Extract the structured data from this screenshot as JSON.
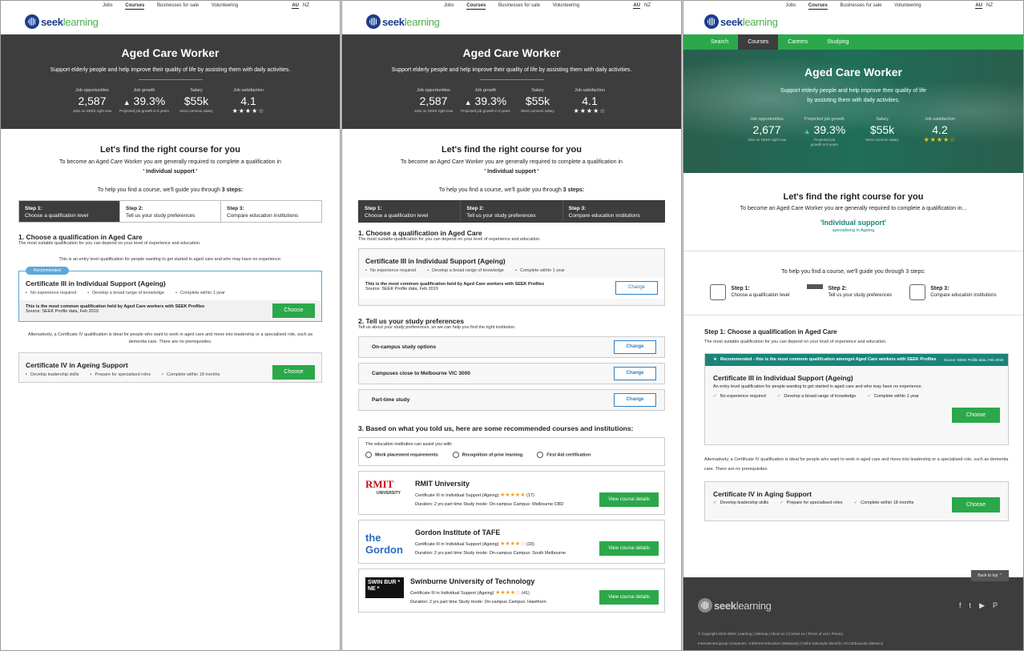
{
  "topnav": {
    "links": [
      "Jobs",
      "Courses",
      "Businesses for sale",
      "Volunteering"
    ],
    "locale": [
      "AU",
      "NZ"
    ]
  },
  "logo": {
    "seek": "seek",
    "learning": "learning"
  },
  "hero": {
    "title": "Aged Care Worker",
    "subtitle": "Support elderly people and help improve their quality of life by assisting them with daily activities.",
    "stats": [
      {
        "label": "Job opportunities",
        "value": "2,587",
        "note": "Jobs on SEEK right now"
      },
      {
        "label": "Job growth",
        "value": "39.3%",
        "note": "Projected job growth in 5 years"
      },
      {
        "label": "Salary",
        "value": "$55k",
        "note": "Most common salary"
      },
      {
        "label": "Job satisfaction",
        "value": "4.1",
        "stars": "★★★★☆"
      }
    ]
  },
  "intro": {
    "title": "Let's find the right course for you",
    "line": "To become an Aged Care Worker you are generally required to complete a qualification in",
    "qualification": "' Individual support '",
    "guide_pre": "To help you find a course, we'll guide you through",
    "guide_bold": "3 steps:"
  },
  "steps": [
    {
      "num": "Step 1:",
      "label": "Choose a qualification level"
    },
    {
      "num": "Step 2:",
      "label": "Tell us your study preferences"
    },
    {
      "num": "Step 3:",
      "label": "Compare education institutions"
    }
  ],
  "p1": {
    "section": "1. Choose a qualification in Aged Care",
    "section_sub": "The most suitable qualification for you can depend on your level of experience and education.",
    "entry_note": "This is an entry level qualification for people wanting to get started in aged care and who may have no experience.",
    "badge": "Recommended",
    "cert3": {
      "title": "Certificate III in Individual Support (Ageing)",
      "features": [
        "No experience required",
        "Develop a broad range of knowledge",
        "Complete within 1 year"
      ],
      "foot_bold": "This is the most common qualification held by Aged Care workers with SEEK Profiles",
      "foot_src": "Source: SEEK Profile data, Feb 2019",
      "button": "Choose"
    },
    "alt_text": "Alternatively, a Certificate IV qualification is ideal for people who want to work in aged care and move into leadership or a specialised role, such as dementia care. There are no prerequisites.",
    "cert4": {
      "title": "Certificate IV in Ageing Support",
      "features": [
        "Develop leadership skills",
        "Prepare for specialised roles",
        "Complete within 18 months"
      ],
      "button": "Choose"
    }
  },
  "p2": {
    "section1": "1. Choose a qualification in Aged Care",
    "section1_sub": "The most suitable qualification for you can depend on your level of experience and education.",
    "cert3": {
      "title": "Certificate III in Individual Support (Ageing)",
      "features": [
        "No experience required",
        "Develop a broad range of knowledge",
        "Complete within 1 year"
      ],
      "foot_bold": "This is the most common qualification held by Aged Care workers with SEEK Profiles",
      "foot_src": "Source: SEEK Profile data, Feb 2019",
      "button": "Change"
    },
    "section2": "2. Tell us your study preferences",
    "section2_sub": "Tell us about your study preferences, so we can help you find the right institution.",
    "prefs": [
      "On-campus study options",
      "Campuses close to Melbourne VIC 3000",
      "Part-time study"
    ],
    "change": "Change",
    "section3": "3. Based on what you told us, here are some recommended courses and institutions:",
    "assist_title": "The education institution can assist you with:",
    "assist": [
      "Work placement requirements",
      "Recognition of prior learning",
      "First Aid certification"
    ],
    "institutions": [
      {
        "logo": "RMIT",
        "logo_sub": "UNIVERSITY",
        "name": "RMIT University",
        "cert": "Certificate III in Individual Support (Ageing)",
        "stars": "★★★★★",
        "count": "(17)",
        "details": "Duration: 2 yrs part time   Study mode: On-campus   Campus: Melbourne CBD",
        "button": "View course details"
      },
      {
        "logo": "the Gordon",
        "logo_sub": "",
        "name": "Gordon Institute of TAFE",
        "cert": "Certificate III in Individual Support (Ageing)",
        "stars": "★★★★☆",
        "count": "(33)",
        "details": "Duration: 2 yrs part time   Study mode: On-campus   Campus: South Melbourne",
        "button": "View course details"
      },
      {
        "logo": "SWIN BUR * NE *",
        "logo_sub": "",
        "name": "Swinburne University of Technology",
        "cert": "Certificate III in Individual Support (Ageing)",
        "stars": "★★★★☆",
        "count": "(41)",
        "details": "Duration: 2 yrs part time   Study mode: On-campus   Campus: Hawthorn",
        "button": "View course details"
      }
    ]
  },
  "p3": {
    "nav": [
      "Search",
      "Courses",
      "Careers",
      "Studying"
    ],
    "hero": {
      "title": "Aged Care Worker",
      "subtitle": "Support elderly people and help improve their quality of life by assisting them with daily activities.",
      "stats": [
        {
          "label": "Job opportunities",
          "value": "2,677",
          "note": "Jobs on SEEK right now"
        },
        {
          "label": "Projected job growth",
          "value": "39.3%",
          "note": "Projected job growth in 5 years"
        },
        {
          "label": "Salary",
          "value": "$55k",
          "note": "Most common salary"
        },
        {
          "label": "Job satisfaction",
          "value": "4.2",
          "stars": "★★★★☆"
        }
      ]
    },
    "intro_line": "To become an Aged Care Worker you are generally required to complete a qualification in...",
    "qual": "'Individual support'",
    "qual_sub": "specialising in Ageing",
    "guide": "To help you find a course, we'll guide you through 3 steps:",
    "step_head": "Step 1: Choose a qualification in Aged Care",
    "step_sub": "The most suitable qualification for you can depend on your level of experience and education.",
    "rec_head": "Recommended  -  this is the most common qualification amongst Aged Care workers with SEEK Profiles",
    "rec_src": "Source: SEEK Profile data, Feb 2019",
    "cert3": {
      "title": "Certificate III in Individual Support (Ageing)",
      "desc": "An entry level qualification for people wanting to get started in aged care and who may have no experience.",
      "features": [
        "No experience required",
        "Develop a broad range of knowledge",
        "Complete within 1 year"
      ],
      "button": "Choose"
    },
    "alt_text": "Alternatively, a Certificate IV qualification is ideal for people who want to work in aged care and move into leadership or a specialised role, such as dementia care. There are no prerequisites.",
    "cert4": {
      "title": "Certificate IV in Aging Support",
      "features": [
        "Develop leadership skills",
        "Prepare for specialised roles",
        "Complete within 18 months"
      ],
      "button": "Choose"
    },
    "back_top": "Back to top",
    "footer_links": "© Copyright 2019 SEEK Learning  |  Sitemap  |  About us  |  Contact us  |  Terms of use  |  Privacy",
    "footer_intl": "International group companies: JobStreet Education (Malaysia)  |  Catho Educação (Brazil)  |  OCCEducación (Mexico)"
  }
}
